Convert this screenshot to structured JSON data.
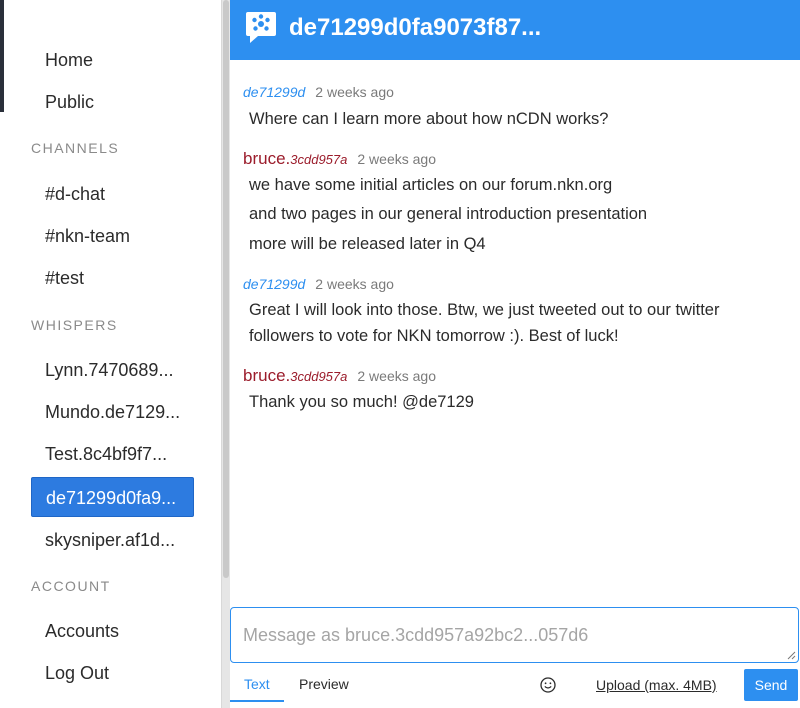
{
  "sidebar": {
    "nav": [
      {
        "label": "Home"
      },
      {
        "label": "Public"
      }
    ],
    "channels_heading": "CHANNELS",
    "channels": [
      {
        "label": "#d-chat"
      },
      {
        "label": "#nkn-team"
      },
      {
        "label": "#test"
      }
    ],
    "whispers_heading": "WHISPERS",
    "whispers": [
      {
        "label": "Lynn.7470689..."
      },
      {
        "label": "Mundo.de7129..."
      },
      {
        "label": "Test.8c4bf9f7..."
      },
      {
        "label": "de71299d0fa9...",
        "active": true
      },
      {
        "label": "skysniper.af1d..."
      }
    ],
    "account_heading": "ACCOUNT",
    "account": [
      {
        "label": "Accounts"
      },
      {
        "label": "Log Out"
      }
    ]
  },
  "header": {
    "title": "de71299d0fa9073f87...",
    "logo_icon": "chat-bubble-logo-icon"
  },
  "messages": [
    {
      "author": "de71299d",
      "time": "2 weeks ago",
      "lines": [
        "Where can I learn more about how nCDN works?"
      ]
    },
    {
      "author_name": "bruce.",
      "author_suffix": "3cdd957a",
      "time": "2 weeks ago",
      "lines": [
        "we have some initial articles on our forum.nkn.org",
        "and two pages in our general introduction presentation",
        "more will be released later in Q4"
      ]
    },
    {
      "author": "de71299d",
      "time": "2 weeks ago",
      "lines": [
        "Great I will look into those. Btw, we just tweeted out to our twitter",
        "followers to vote for NKN tomorrow :). Best of luck!"
      ]
    },
    {
      "author_name": "bruce.",
      "author_suffix": "3cdd957a",
      "time": "2 weeks ago",
      "lines": [
        "Thank you so much! @de7129"
      ]
    }
  ],
  "composer": {
    "placeholder": "Message as bruce.3cdd957a92bc2...057d6",
    "tabs": [
      {
        "label": "Text",
        "active": true
      },
      {
        "label": "Preview"
      }
    ],
    "emoji_icon": "smiley-face-icon",
    "upload_label": "Upload (max. 4MB)",
    "send_label": "Send"
  },
  "colors": {
    "accent": "#2d8ff0",
    "active_item": "#2d7be0",
    "other_author": "#9b1c2b"
  }
}
